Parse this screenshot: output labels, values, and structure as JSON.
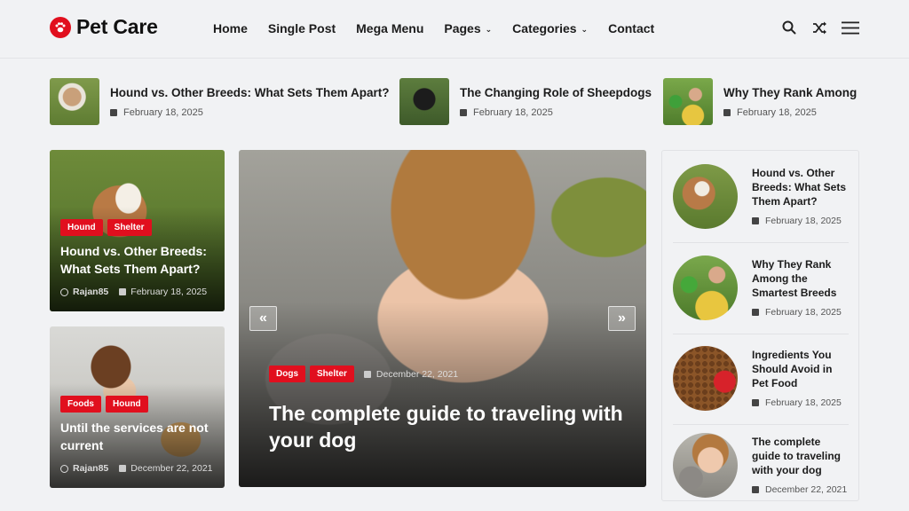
{
  "brand": {
    "name": "Pet Care",
    "accent": "#e10f1e"
  },
  "nav": [
    {
      "label": "Home",
      "dropdown": false
    },
    {
      "label": "Single Post",
      "dropdown": false
    },
    {
      "label": "Mega Menu",
      "dropdown": false
    },
    {
      "label": "Pages",
      "dropdown": true
    },
    {
      "label": "Categories",
      "dropdown": true
    },
    {
      "label": "Contact",
      "dropdown": false
    }
  ],
  "header_icons": [
    "search-icon",
    "shuffle-icon",
    "menu-icon"
  ],
  "ticker": [
    {
      "title": "Hound vs. Other Breeds: What Sets Them Apart?",
      "date": "February 18, 2025"
    },
    {
      "title": "The Changing Role of Sheepdogs",
      "date": "February 18, 2025"
    },
    {
      "title": "Why They Rank Among t",
      "date": "February 18, 2025"
    }
  ],
  "left_cards": [
    {
      "tags": [
        "Hound",
        "Shelter"
      ],
      "title": "Hound vs. Other Breeds: What Sets Them Apart?",
      "author": "Rajan85",
      "date": "February 18, 2025"
    },
    {
      "tags": [
        "Foods",
        "Hound"
      ],
      "title": "Until the services are not current",
      "author": "Rajan85",
      "date": "December 22, 2021"
    }
  ],
  "hero": {
    "tags": [
      "Dogs",
      "Shelter"
    ],
    "date": "December 22, 2021",
    "title": "The complete guide to traveling with your dog",
    "prev": "«",
    "next": "»"
  },
  "sidebar": [
    {
      "title": "Hound vs. Other Breeds: What Sets Them Apart?",
      "date": "February 18, 2025"
    },
    {
      "title": "Why They Rank Among the Smartest Breeds",
      "date": "February 18, 2025"
    },
    {
      "title": "Ingredients You Should Avoid in Pet Food",
      "date": "February 18, 2025"
    },
    {
      "title": "The complete guide to traveling with your dog",
      "date": "December 22, 2021"
    }
  ]
}
